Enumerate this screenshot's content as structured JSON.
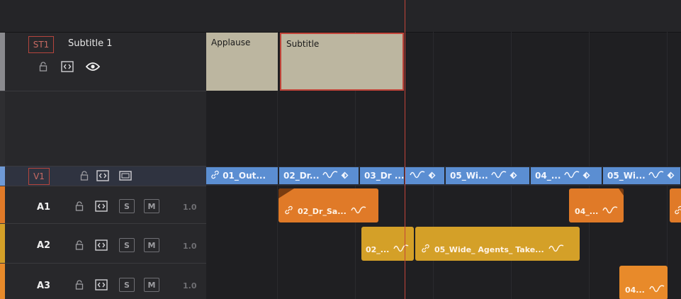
{
  "subtitle_track": {
    "id": "ST1",
    "name": "Subtitle 1",
    "clips": [
      {
        "label": "Applause"
      },
      {
        "label": "Subtitle"
      }
    ]
  },
  "video_track": {
    "id": "V1",
    "clips": [
      {
        "label": "01_Out..."
      },
      {
        "label": "02_Dr..."
      },
      {
        "label": "03_Dr ..."
      },
      {
        "label": ""
      },
      {
        "label": "05_Wi..."
      },
      {
        "label": "04_..."
      },
      {
        "label": "05_Wi..."
      }
    ]
  },
  "audio_tracks": [
    {
      "label": "A1",
      "solo_label": "S",
      "mute_label": "M",
      "gain": "1.0",
      "clips": [
        {
          "label": "02_Dr_Sa..."
        },
        {
          "label": "04_..."
        },
        {
          "label": ""
        }
      ]
    },
    {
      "label": "A2",
      "solo_label": "S",
      "mute_label": "M",
      "gain": "1.0",
      "clips": [
        {
          "label": "02_..."
        },
        {
          "label": "05_Wide_ Agents_ Take..."
        }
      ]
    },
    {
      "label": "A3",
      "solo_label": "S",
      "mute_label": "M",
      "gain": "1.0",
      "clips": [
        {
          "label": "04..."
        }
      ]
    }
  ],
  "colors": {
    "subtitle_clip": "#bcb6a0",
    "selected_clip_border": "#c2443a",
    "video_clip": "#5b8ed2",
    "audio_a1_clip": "#e07a28",
    "audio_a2_clip": "#d4a028",
    "audio_a3_clip": "#e88a2a",
    "playhead": "#c2443a"
  }
}
